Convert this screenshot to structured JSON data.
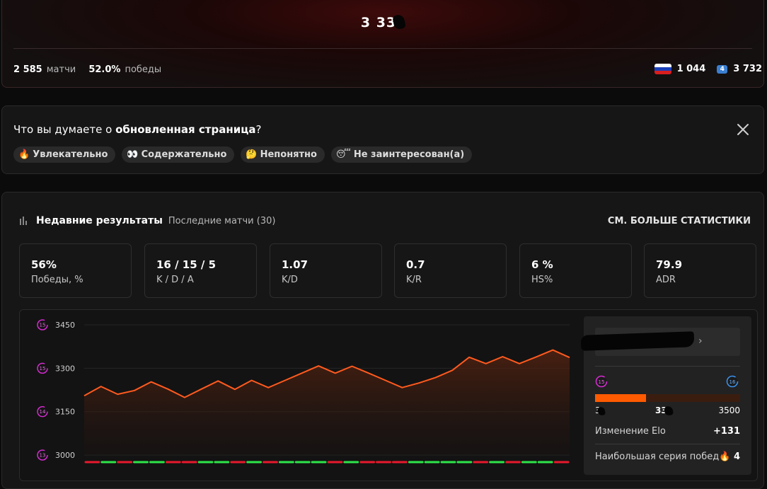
{
  "header": {
    "elo": "3 33",
    "matches_value": "2 585",
    "matches_label": "матчи",
    "winrate_value": "52.0%",
    "winrate_label": "победы",
    "country_rank": "1 044",
    "region_badge": "4",
    "region_rank": "3 732"
  },
  "feedback": {
    "question_prefix": "Что вы думаете о ",
    "question_subject": "обновленная страница",
    "question_suffix": "?",
    "options": [
      {
        "emoji": "🔥",
        "label": "Увлекательно"
      },
      {
        "emoji": "👀",
        "label": "Содержательно"
      },
      {
        "emoji": "🤔",
        "label": "Непонятно"
      },
      {
        "emoji": "😴",
        "label": "Не заинтересован(а)"
      }
    ]
  },
  "stats": {
    "title": "Недавние результаты",
    "subtitle": "Последние матчи (30)",
    "more_link": "СМ. БОЛЬШЕ СТАТИСТИКИ",
    "tiles": [
      {
        "value": "56%",
        "label": "Победы, %"
      },
      {
        "value": "16 / 15 / 5",
        "label": "K / D / A"
      },
      {
        "value": "1.07",
        "label": "K/D"
      },
      {
        "value": "0.7",
        "label": "K/R"
      },
      {
        "value": "6 %",
        "label": "HS%"
      },
      {
        "value": "79.9",
        "label": "ADR"
      }
    ]
  },
  "chart_data": {
    "type": "area",
    "y_ticks": [
      3450,
      3300,
      3150,
      3000
    ],
    "y_tick_levels": [
      "15",
      "15",
      "14",
      "13"
    ],
    "ylim": [
      3000,
      3450
    ],
    "values": [
      3205,
      3237,
      3210,
      3223,
      3253,
      3228,
      3199,
      3228,
      3256,
      3227,
      3258,
      3233,
      3258,
      3283,
      3308,
      3283,
      3307,
      3283,
      3258,
      3233,
      3249,
      3268,
      3293,
      3338,
      3316,
      3340,
      3316,
      3339,
      3363,
      3337
    ],
    "results": [
      "L",
      "W",
      "L",
      "W",
      "W",
      "L",
      "L",
      "W",
      "W",
      "L",
      "W",
      "L",
      "W",
      "W",
      "W",
      "L",
      "W",
      "L",
      "L",
      "L",
      "W",
      "W",
      "W",
      "W",
      "L",
      "W",
      "L",
      "W",
      "W",
      "L"
    ],
    "colors": {
      "line": "#ff5a1f",
      "win": "#2ee64a",
      "loss": "#e8192c"
    }
  },
  "side_panel": {
    "current_level": "15",
    "next_level": "16",
    "progress": 0.35,
    "range_min_label": "3",
    "current_elo_label": "33",
    "range_max_label": "3500",
    "elo_change_label": "Изменение Elo",
    "elo_change_value": "+131",
    "streak_label": "Наибольшая серия побед",
    "streak_emoji": "🔥",
    "streak_value": "4"
  }
}
